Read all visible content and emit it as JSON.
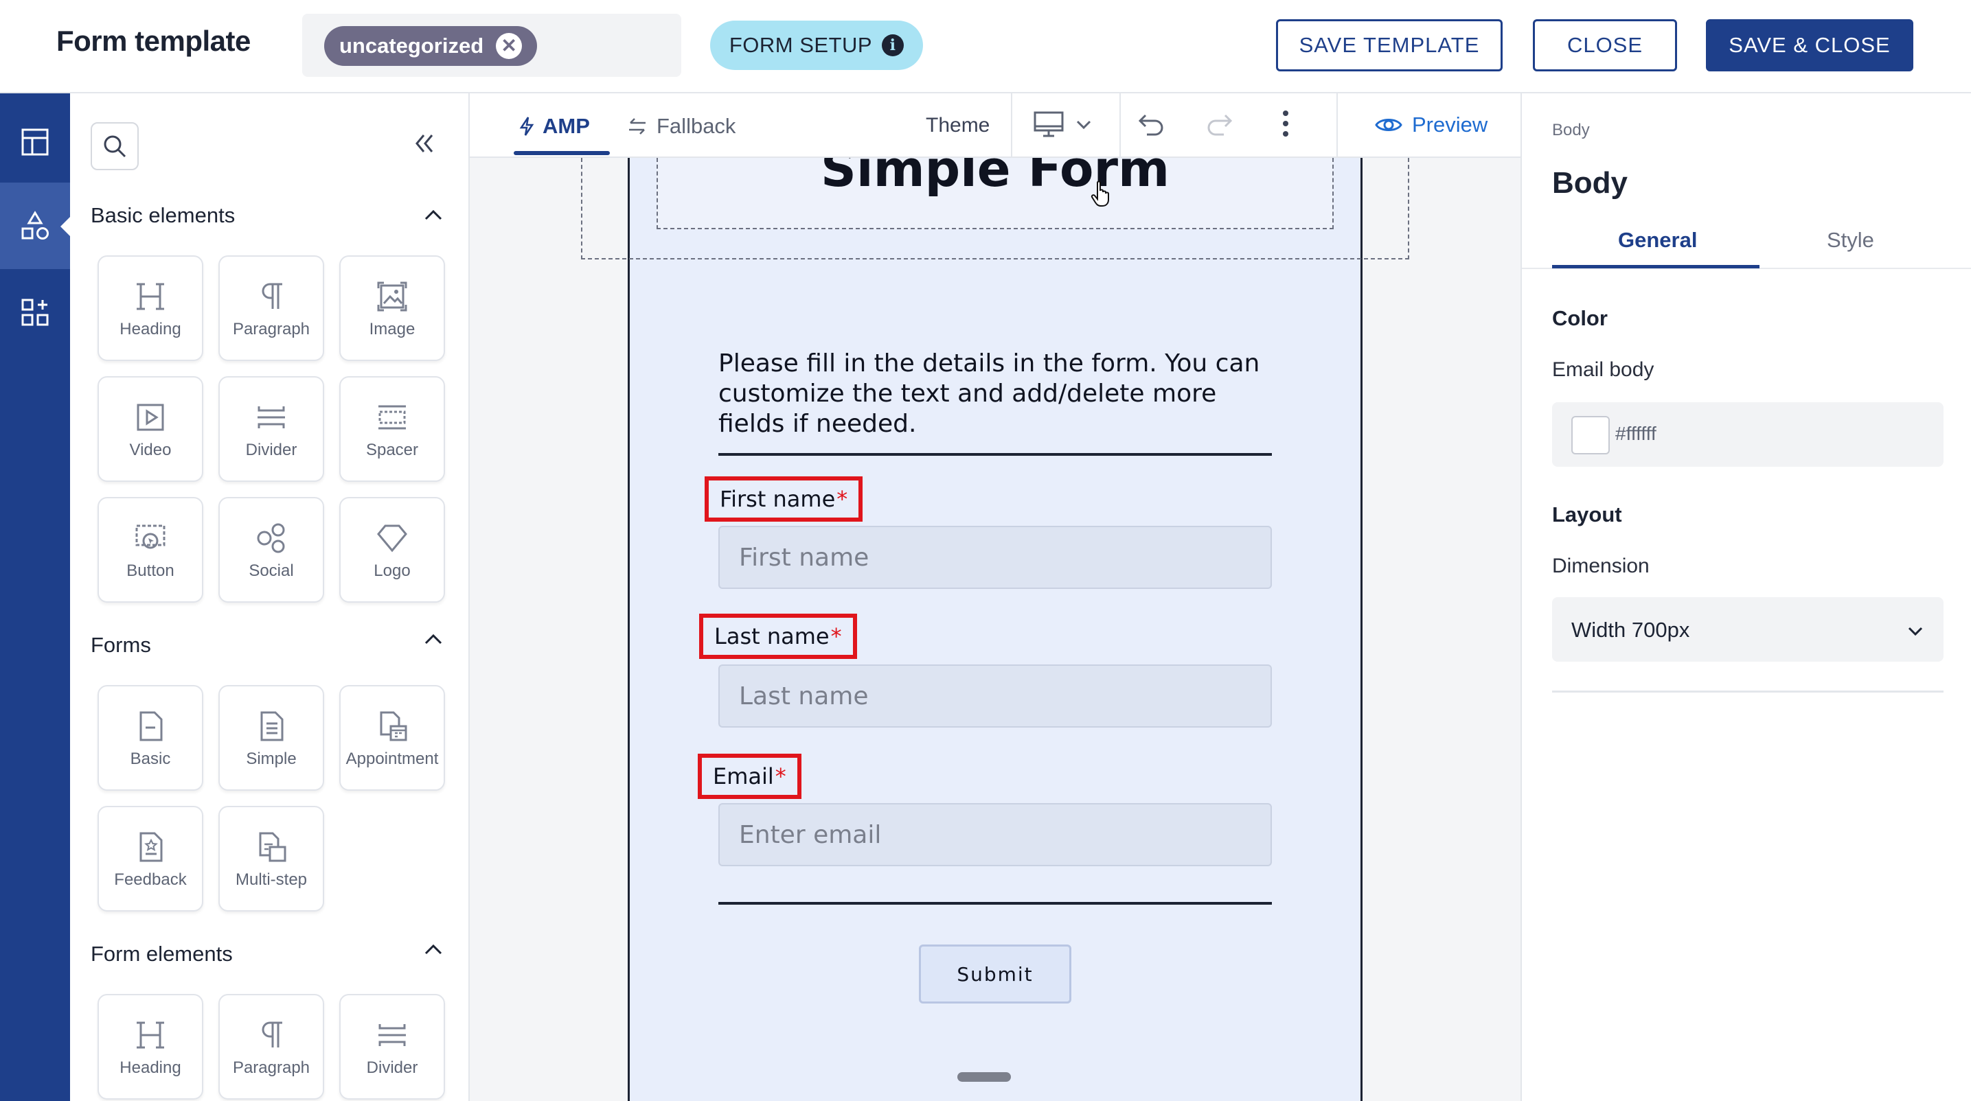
{
  "header": {
    "title": "Form template",
    "category_tag": "uncategorized",
    "form_setup_label": "FORM SETUP",
    "save_template_label": "SAVE TEMPLATE",
    "close_label": "CLOSE",
    "save_close_label": "SAVE & CLOSE"
  },
  "rail": {
    "items": [
      {
        "icon": "layout-icon"
      },
      {
        "icon": "shapes-icon",
        "active": true
      },
      {
        "icon": "apps-add-icon"
      }
    ]
  },
  "panel": {
    "collapse_icon": "double-chevron-left-icon",
    "sections": [
      {
        "title": "Basic elements",
        "tiles": [
          "Heading",
          "Paragraph",
          "Image",
          "Video",
          "Divider",
          "Spacer",
          "Button",
          "Social",
          "Logo"
        ]
      },
      {
        "title": "Forms",
        "tiles": [
          "Basic",
          "Simple",
          "Appointment",
          "Feedback",
          "Multi-step"
        ]
      },
      {
        "title": "Form elements",
        "tiles": [
          "Heading",
          "Paragraph",
          "Divider"
        ]
      }
    ]
  },
  "toolbar": {
    "tab_amp": "AMP",
    "tab_fallback": "Fallback",
    "theme_label": "Theme",
    "preview_label": "Preview"
  },
  "form": {
    "title": "Simple Form",
    "intro": "Please fill in the details in the form. You can customize the text and add/delete more fields if needed.",
    "fields": [
      {
        "label": "First name",
        "required_mark": "*",
        "placeholder": "First name"
      },
      {
        "label": "Last name",
        "required_mark": "*",
        "placeholder": "Last name"
      },
      {
        "label": "Email",
        "required_mark": "*",
        "placeholder": "Enter email"
      }
    ],
    "submit_label": "Submit"
  },
  "properties": {
    "breadcrumb": "Body",
    "title": "Body",
    "tab_general": "General",
    "tab_style": "Style",
    "color_heading": "Color",
    "email_body_label": "Email body",
    "email_body_color": "#ffffff",
    "layout_heading": "Layout",
    "dimension_label": "Dimension",
    "dimension_value": "Width 700px"
  },
  "colors": {
    "brand": "#1e3f8a",
    "highlight": "#e0151c",
    "canvas": "#e8eefb"
  }
}
